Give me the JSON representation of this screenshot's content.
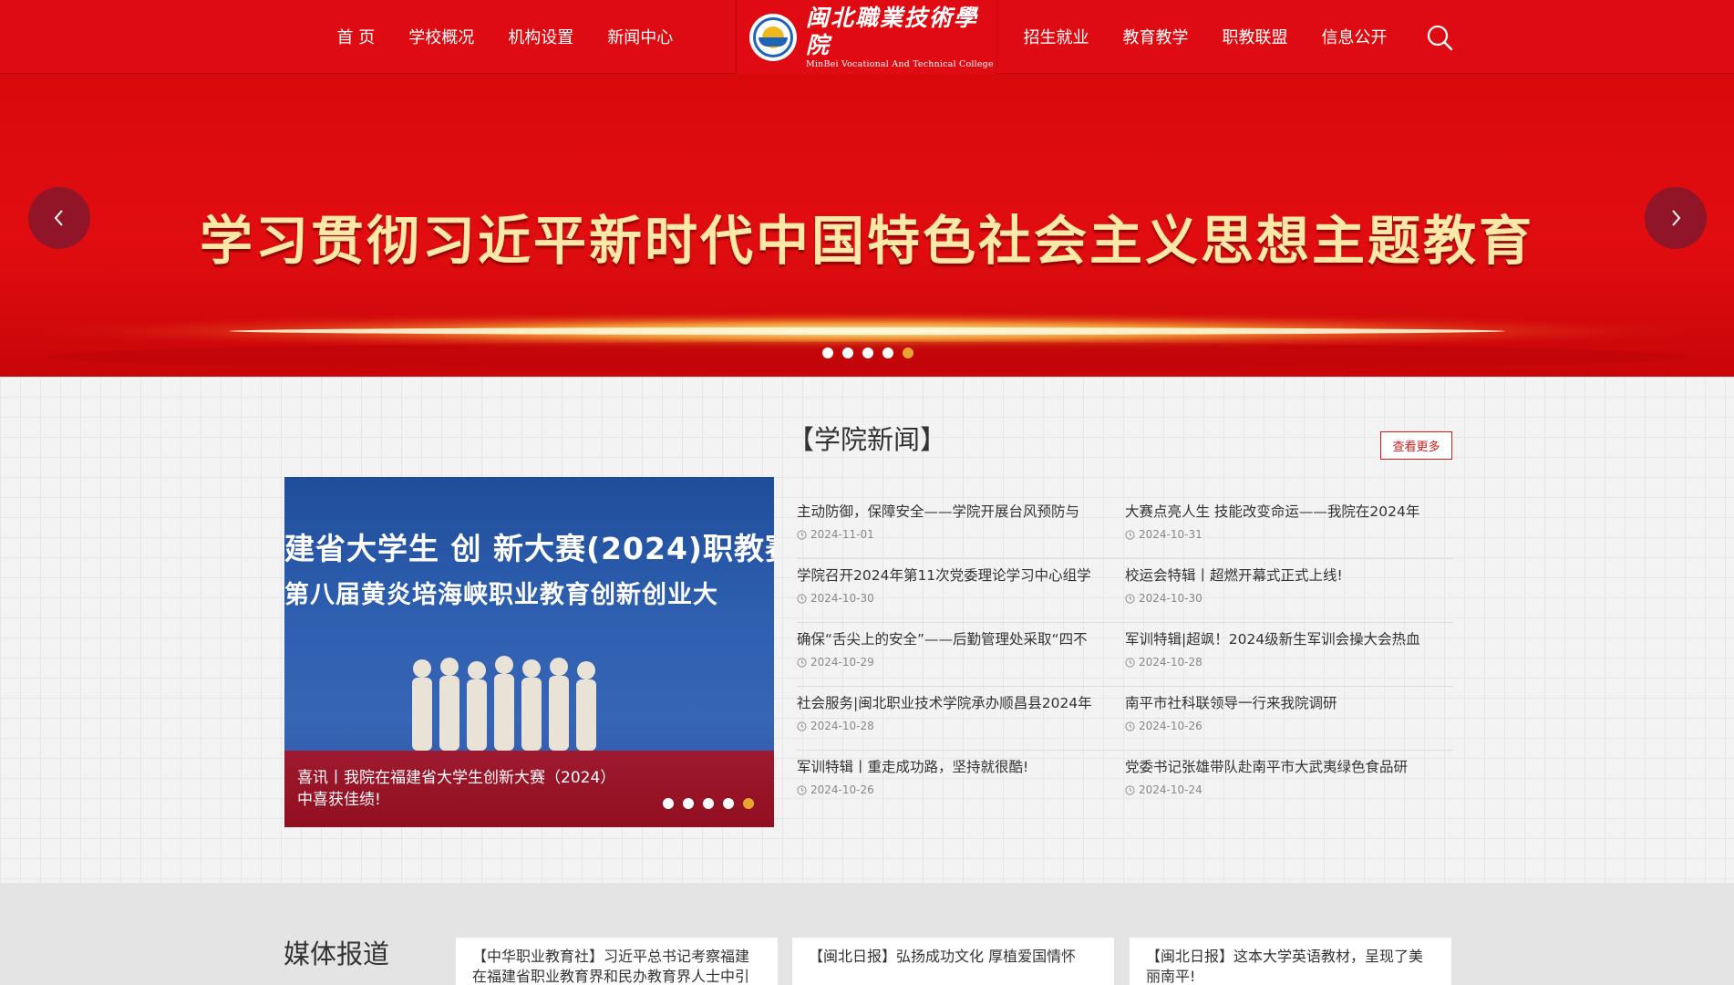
{
  "header": {
    "nav_left": [
      "首 页",
      "学校概况",
      "机构设置",
      "新闻中心"
    ],
    "nav_right": [
      "招生就业",
      "教育教学",
      "职教联盟",
      "信息公开"
    ],
    "logo_cn": "闽北職業技術學院",
    "logo_en": "MinBei Vocational And Technical College"
  },
  "banner": {
    "title": "学习贯彻习近平新时代中国特色社会主义思想主题教育",
    "dots_count": 5,
    "active_dot": 4
  },
  "news": {
    "section_title": "【学院新闻】",
    "more_label": "查看更多",
    "feature": {
      "line1": "建省大学生 创 新大赛(2024)职教赛",
      "line2": "第八届黄炎培海峡职业教育创新创业大",
      "caption": "喜讯丨我院在福建省大学生创新大赛（2024）中喜获佳绩!",
      "dots_count": 5,
      "active_dot": 4
    },
    "left_items": [
      {
        "title": "主动防御，保障安全——学院开展台风预防与",
        "date": "2024-11-01"
      },
      {
        "title": "学院召开2024年第11次党委理论学习中心组学",
        "date": "2024-10-30"
      },
      {
        "title": "确保“舌尖上的安全”——后勤管理处采取“四不",
        "date": "2024-10-29"
      },
      {
        "title": "社会服务|闽北职业技术学院承办顺昌县2024年",
        "date": "2024-10-28"
      },
      {
        "title": "军训特辑丨重走成功路，坚持就很酷!",
        "date": "2024-10-26"
      }
    ],
    "right_items": [
      {
        "title": "大赛点亮人生 技能改变命运——我院在2024年",
        "date": "2024-10-31"
      },
      {
        "title": "校运会特辑丨超燃开幕式正式上线!",
        "date": "2024-10-30"
      },
      {
        "title": "军训特辑|超飒！2024级新生军训会操大会热血",
        "date": "2024-10-28"
      },
      {
        "title": "南平市社科联领导一行来我院调研",
        "date": "2024-10-26"
      },
      {
        "title": "党委书记张雄带队赴南平市大武夷绿色食品研",
        "date": "2024-10-24"
      }
    ]
  },
  "media": {
    "title": "媒体报道",
    "cards": [
      "【中华职业教育社】习近平总书记考察福建在福建省职业教育界和民办教育界人士中引起",
      "【闽北日报】弘扬成功文化 厚植爱国情怀",
      "【闽北日报】这本大学英语教材，呈现了美丽南平!"
    ]
  },
  "colors": {
    "header_red": "#de0b13",
    "banner_text": "#fde8a8",
    "active_dot": "#e8a531",
    "more_border": "#d31a1a"
  }
}
